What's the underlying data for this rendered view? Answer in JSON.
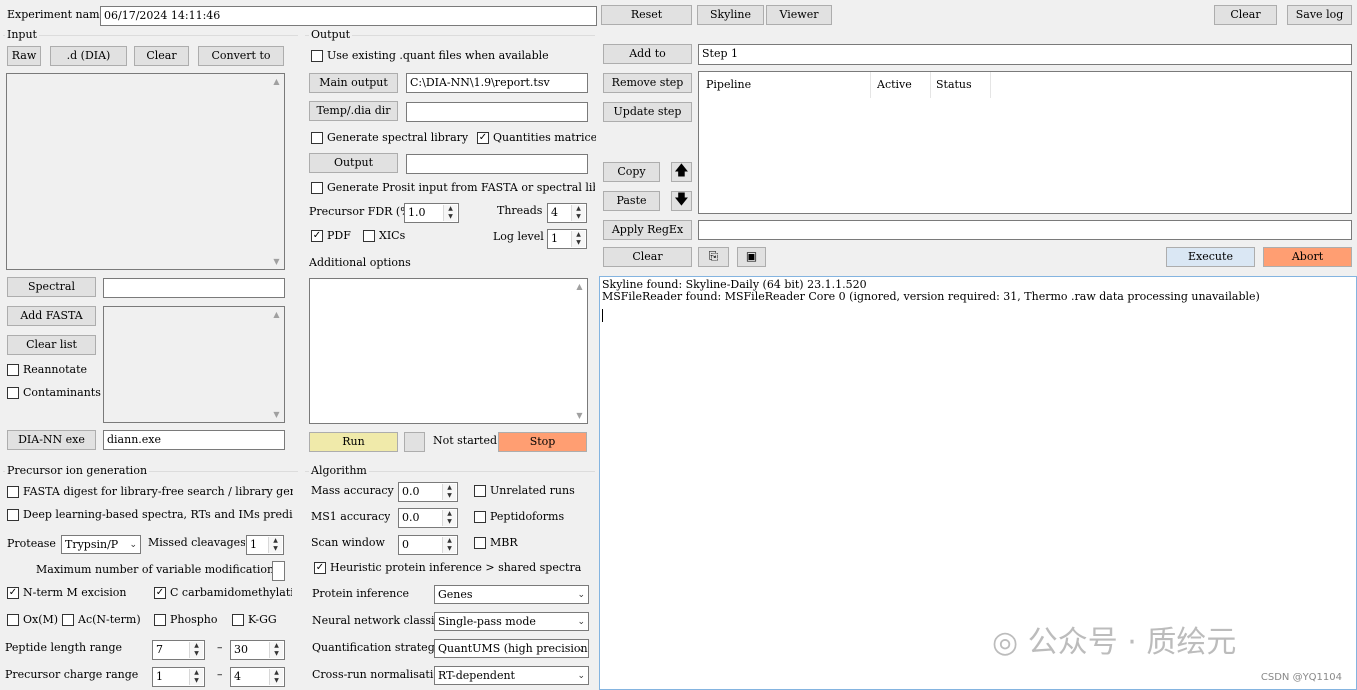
{
  "top": {
    "experiment_label": "Experiment name",
    "experiment_value": "06/17/2024 14:11:46",
    "reset": "Reset",
    "skyline": "Skyline",
    "viewer": "Viewer",
    "clear": "Clear",
    "save_log": "Save log"
  },
  "input": {
    "title": "Input",
    "raw": "Raw",
    "d_dia": ".d (DIA)",
    "clear": "Clear",
    "convert_to": "Convert to",
    "spectral": "Spectral",
    "spectral_value": "",
    "add_fasta": "Add FASTA",
    "clear_list": "Clear list",
    "reannotate": "Reannotate",
    "contaminants": "Contaminants",
    "diann_exe": "DIA-NN exe",
    "diann_exe_value": "diann.exe"
  },
  "output": {
    "title": "Output",
    "use_existing": "Use existing .quant files when available",
    "main_output": "Main output",
    "main_output_value": "C:\\DIA-NN\\1.9\\report.tsv",
    "temp_dia_dir": "Temp/.dia dir",
    "temp_value": "",
    "gen_spectral_library": "Generate spectral library",
    "quantities_matrices": "Quantities matrices",
    "output_btn": "Output",
    "output_value": "",
    "gen_prosit": "Generate Prosit input from FASTA or spectral library",
    "precursor_fdr_label": "Precursor FDR (%)",
    "precursor_fdr_value": "1.0",
    "threads_label": "Threads",
    "threads_value": "4",
    "pdf": "PDF",
    "xics": "XICs",
    "log_level_label": "Log level",
    "log_level_value": "1",
    "additional_options": "Additional options",
    "run": "Run",
    "status": "Not started",
    "stop": "Stop"
  },
  "precursor": {
    "title": "Precursor ion generation",
    "fasta_digest": "FASTA digest for library-free search / library generation",
    "deep_learning": "Deep learning-based spectra, RTs and IMs prediction",
    "protease_label": "Protease",
    "protease_value": "Trypsin/P",
    "missed_cleavages_label": "Missed cleavages",
    "missed_cleavages_value": "1",
    "max_var_mods_label": "Maximum number of variable modifications",
    "max_var_mods_value": "",
    "nterm_m_excision": "N-term M excision",
    "c_carbamidomethylation": "C carbamidomethylation",
    "ox_m": "Ox(M)",
    "ac_nterm": "Ac(N-term)",
    "phospho": "Phospho",
    "k_gg": "K-GG",
    "peptide_length_label": "Peptide length range",
    "peptide_length_min": "7",
    "peptide_length_max": "30",
    "charge_range_label": "Precursor charge range",
    "charge_min": "1",
    "charge_max": "4",
    "dash": "–"
  },
  "algorithm": {
    "title": "Algorithm",
    "mass_accuracy_label": "Mass accuracy",
    "mass_accuracy_value": "0.0",
    "ms1_accuracy_label": "MS1 accuracy",
    "ms1_accuracy_value": "0.0",
    "scan_window_label": "Scan window",
    "scan_window_value": "0",
    "unrelated_runs": "Unrelated runs",
    "peptidoforms": "Peptidoforms",
    "mbr": "MBR",
    "heuristic": "Heuristic protein inference > shared spectra",
    "protein_inference_label": "Protein inference",
    "protein_inference_value": "Genes",
    "neural_network_label": "Neural network classifier",
    "neural_network_value": "Single-pass mode",
    "quant_strategy_label": "Quantification strategy",
    "quant_strategy_value": "QuantUMS (high precision)",
    "crossrun_label": "Cross-run normalisation",
    "crossrun_value": "RT-dependent"
  },
  "pipeline": {
    "add_to": "Add to",
    "step_value": "Step 1",
    "remove_step": "Remove step",
    "update_step": "Update step",
    "columns": [
      "Pipeline",
      "Active",
      "Status"
    ],
    "copy": "Copy",
    "paste": "Paste",
    "apply_regex": "Apply RegEx",
    "regex_value": "",
    "clear": "Clear",
    "execute": "Execute",
    "abort": "Abort"
  },
  "log": {
    "lines": [
      "Skyline found: Skyline-Daily (64 bit) 23.1.1.520",
      "MSFileReader found: MSFileReader Core 0 (ignored, version required: 31, Thermo .raw data processing unavailable)"
    ]
  },
  "watermark": {
    "text": "公众号 · 质绘元",
    "credit": "CSDN @YQ1104"
  },
  "colors": {
    "run": "#f0eaaa",
    "stop": "#ff9e72",
    "execute": "#dae7f4",
    "abort": "#ff9e72"
  }
}
